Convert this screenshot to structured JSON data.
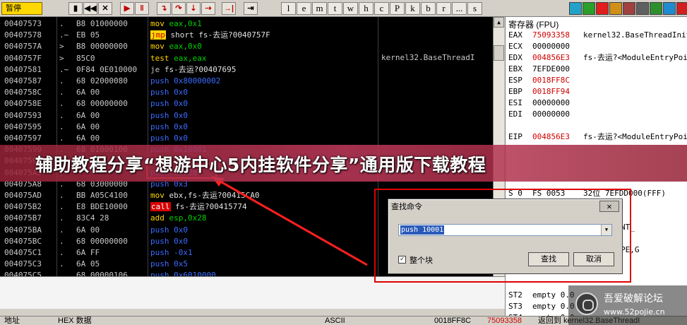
{
  "toolbar": {
    "status": "暂停",
    "debug_buttons": [
      {
        "name": "open",
        "glyph": "▮",
        "color": "#000000"
      },
      {
        "name": "rewind",
        "glyph": "◀◀",
        "color": "#000000"
      },
      {
        "name": "close",
        "glyph": "✕",
        "color": "#000000"
      },
      {
        "name": "run",
        "glyph": "▶",
        "color": "#c00000"
      },
      {
        "name": "pause",
        "glyph": "‖",
        "color": "#c00000"
      },
      {
        "name": "step-into",
        "glyph": "↴",
        "color": "#c00000"
      },
      {
        "name": "step-over",
        "glyph": "↷",
        "color": "#c00000"
      },
      {
        "name": "trace-into",
        "glyph": "⇣",
        "color": "#c00000"
      },
      {
        "name": "trace-over",
        "glyph": "⇢",
        "color": "#c00000"
      },
      {
        "name": "execute-till-return",
        "glyph": "→|",
        "color": "#c00000"
      },
      {
        "name": "go-to",
        "glyph": "⇥",
        "color": "#000000"
      }
    ],
    "window_letters": [
      "l",
      "e",
      "m",
      "t",
      "w",
      "h",
      "c",
      "P",
      "k",
      "b",
      "r",
      "...",
      "s"
    ],
    "right_icons": [
      {
        "name": "settings",
        "color": "#22a2c8"
      },
      {
        "name": "plugin-a",
        "color": "#2aa02a"
      },
      {
        "name": "plugin-b",
        "color": "#e01e1e"
      },
      {
        "name": "plugin-c",
        "color": "#d09018"
      },
      {
        "name": "plugin-d",
        "color": "#a04040"
      },
      {
        "name": "plugin-e",
        "color": "#606060"
      },
      {
        "name": "plugin-f",
        "color": "#2f8f2f"
      },
      {
        "name": "plugin-g",
        "color": "#208cd0"
      },
      {
        "name": "plugin-h",
        "color": "#d02020"
      }
    ]
  },
  "disasm": {
    "rows": [
      {
        "addr": "00407573",
        "mark": ".",
        "hex": "B8 01000000",
        "mn": "mov",
        "ops": "eax,0x1",
        "opclass": "op-g"
      },
      {
        "addr": "00407578",
        "mark": ".~",
        "hex": "EB 05",
        "mn": "jmp",
        "ops": "short fs-去运?0040757F",
        "opclass": "op-w"
      },
      {
        "addr": "0040757A",
        "mark": ">",
        "hex": "B8 00000000",
        "mn": "mov",
        "ops": "eax,0x0",
        "opclass": "op-g"
      },
      {
        "addr": "0040757F",
        "mark": ">",
        "hex": "85C0",
        "mn": "test",
        "ops": "eax,eax",
        "opclass": "op-g"
      },
      {
        "addr": "00407581",
        "mark": ".~",
        "hex": "0F84 0E010000",
        "mn": "je",
        "ops": "fs-去运?00407695",
        "opclass": "op-w"
      },
      {
        "addr": "00407587",
        "mark": ".",
        "hex": "68 02000080",
        "mn": "push",
        "ops": "0x80000002",
        "opclass": "op-b"
      },
      {
        "addr": "0040758C",
        "mark": ".",
        "hex": "6A 00",
        "mn": "push",
        "ops": "0x0",
        "opclass": "op-b"
      },
      {
        "addr": "0040758E",
        "mark": ".",
        "hex": "68 00000000",
        "mn": "push",
        "ops": "0x0",
        "opclass": "op-b"
      },
      {
        "addr": "00407593",
        "mark": ".",
        "hex": "6A 00",
        "mn": "push",
        "ops": "0x0",
        "opclass": "op-b"
      },
      {
        "addr": "00407595",
        "mark": ".",
        "hex": "6A 00",
        "mn": "push",
        "ops": "0x0",
        "opclass": "op-b"
      },
      {
        "addr": "00407597",
        "mark": ".",
        "hex": "6A 00",
        "mn": "push",
        "ops": "0x0",
        "opclass": "op-b"
      },
      {
        "addr": "00407599",
        "mark": ".",
        "hex": "68 01000100",
        "mn": "push",
        "ops": "0x10001",
        "opclass": "op-b"
      },
      {
        "addr": "0040759E",
        "mark": ".",
        "hex": "",
        "mn": "",
        "ops": "",
        "opclass": "op-b"
      },
      {
        "addr": "004075A3",
        "mark": ".",
        "hex": "",
        "mn": "push",
        "ops": "0x520",
        "opclass": "op-b"
      },
      {
        "addr": "004075A8",
        "mark": ".",
        "hex": "68 03000000",
        "mn": "push",
        "ops": "0x3",
        "opclass": "op-b"
      },
      {
        "addr": "004075AD",
        "mark": ".",
        "hex": "BB A05C4100",
        "mn": "mov",
        "ops": "ebx,fs-去运?00415CA0",
        "opclass": "op-w"
      },
      {
        "addr": "004075B2",
        "mark": ".",
        "hex": "E8 BDE10000",
        "mn": "call",
        "ops": "fs-去运?00415774",
        "opclass": "op-w"
      },
      {
        "addr": "004075B7",
        "mark": ".",
        "hex": "83C4 28",
        "mn": "add",
        "ops": "esp,0x28",
        "opclass": "op-g"
      },
      {
        "addr": "004075BA",
        "mark": ".",
        "hex": "6A 00",
        "mn": "push",
        "ops": "0x0",
        "opclass": "op-b"
      },
      {
        "addr": "004075BC",
        "mark": ".",
        "hex": "68 00000000",
        "mn": "push",
        "ops": "0x0",
        "opclass": "op-b"
      },
      {
        "addr": "004075C1",
        "mark": ".",
        "hex": "6A FF",
        "mn": "push",
        "ops": "-0x1",
        "opclass": "op-b"
      },
      {
        "addr": "004075C3",
        "mark": ".",
        "hex": "6A 05",
        "mn": "push",
        "ops": "0x5",
        "opclass": "op-b"
      },
      {
        "addr": "004075C5",
        "mark": ".",
        "hex": "68 00000106",
        "mn": "push",
        "ops": "0x6010000",
        "opclass": "op-b"
      }
    ],
    "side_comment": "kernel32.BaseThreadI"
  },
  "registers": {
    "title": "寄存器 (FPU)",
    "rows": [
      {
        "name": "EAX",
        "value": "75093358",
        "red": true,
        "comment": "kernel32.BaseThreadInitThunk"
      },
      {
        "name": "ECX",
        "value": "00000000",
        "red": false,
        "comment": ""
      },
      {
        "name": "EDX",
        "value": "004856E3",
        "red": true,
        "comment": "fs-去运?<ModuleEntryPoint>"
      },
      {
        "name": "EBX",
        "value": "7EFDE000",
        "red": false,
        "comment": ""
      },
      {
        "name": "ESP",
        "value": "0018FF8C",
        "red": true,
        "comment": ""
      },
      {
        "name": "EBP",
        "value": "0018FF94",
        "red": true,
        "comment": ""
      },
      {
        "name": "ESI",
        "value": "00000000",
        "red": false,
        "comment": ""
      },
      {
        "name": "EDI",
        "value": "00000000",
        "red": false,
        "comment": ""
      },
      {
        "name": "",
        "value": "",
        "red": false,
        "comment": ""
      },
      {
        "name": "EIP",
        "value": "004856E3",
        "red": true,
        "comment": "fs-去运?<ModuleEntryPoint>"
      },
      {
        "name": "",
        "value": "",
        "red": false,
        "comment": ""
      },
      {
        "name": "",
        "value": "",
        "red": false,
        "comment": ""
      },
      {
        "name": "",
        "value": "",
        "red": false,
        "comment": ""
      },
      {
        "name": "",
        "value": "",
        "red": false,
        "comment": ""
      },
      {
        "name": "S 0",
        "value": "FS 0053",
        "red": false,
        "comment": "32位 7EFDD000(FFF)"
      },
      {
        "name": "",
        "value": "",
        "red": false,
        "comment": "FFFFFFF)"
      },
      {
        "name": "",
        "value": "",
        "red": false,
        "comment": ""
      },
      {
        "name": "",
        "value": "",
        "red": false,
        "comment": "SUFFICIENT_"
      },
      {
        "name": "",
        "value": "",
        "red": false,
        "comment": ""
      },
      {
        "name": "",
        "value": "",
        "red": false,
        "comment": "E,BE,NS,PE,G"
      },
      {
        "name": "",
        "value": "",
        "red": false,
        "comment": ""
      },
      {
        "name": "",
        "value": "",
        "red": false,
        "comment": ""
      },
      {
        "name": "",
        "value": "",
        "red": false,
        "comment": ""
      },
      {
        "name": "ST2",
        "value": "empty 0.0",
        "red": false,
        "comment": ""
      },
      {
        "name": "ST3",
        "value": "empty 0.0",
        "red": false,
        "comment": ""
      },
      {
        "name": "ST4",
        "value": "empty 0.0",
        "red": false,
        "comment": ""
      }
    ]
  },
  "dialog": {
    "title": "查找命令",
    "close": "✕",
    "input_value": "push 10001",
    "checkbox_label": "整个块",
    "checkbox_checked": "✓",
    "find_button": "查找",
    "cancel_button": "取消"
  },
  "banner": {
    "text": "辅助教程分享“想游中心5内挂软件分享”通用版下载教程"
  },
  "bottom_bar": {
    "addr_header": "地址",
    "hex_header": "HEX 数据",
    "ascii_header": "ASCII",
    "stack_addr": "0018FF8C",
    "stack_value": "75093358",
    "stack_comment": "返回到 kernel32.BaseThreadI"
  },
  "watermark": {
    "name": "吾爱破解论坛",
    "url": "www.52pojie.cn"
  }
}
